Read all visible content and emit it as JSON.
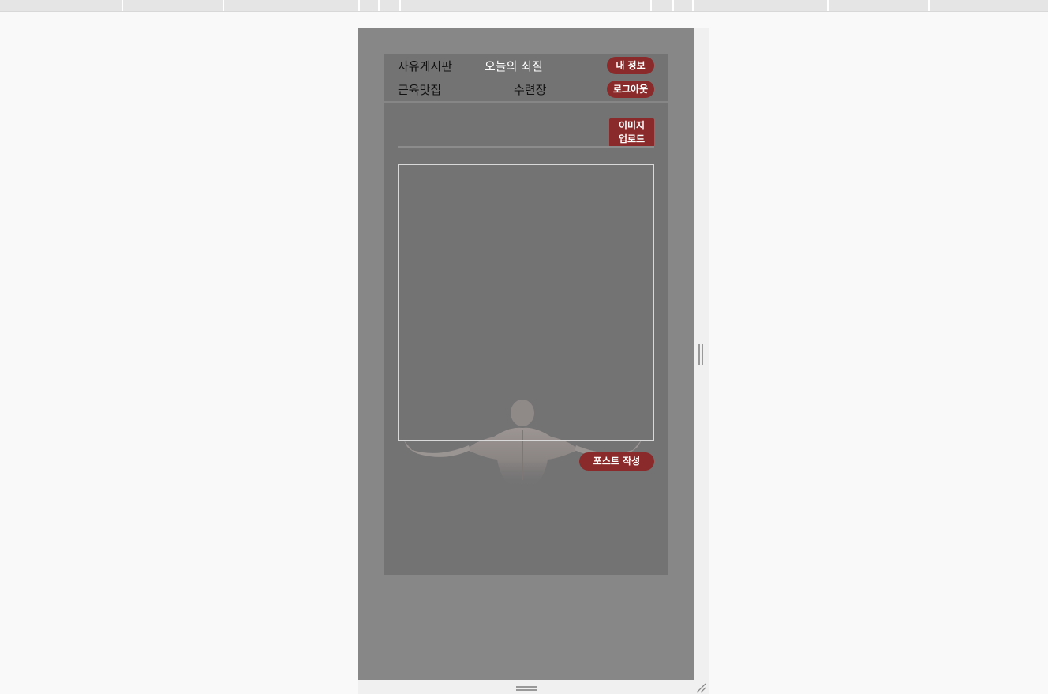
{
  "nav": {
    "free_board": "자유게시판",
    "todays_workout": "오늘의 쇠질",
    "muscle_food": "근육맛집",
    "dojo": "수련장",
    "my_info": "내 정보",
    "logout": "로그아웃"
  },
  "editor": {
    "upload_label_line1": "이미지",
    "upload_label_line2": "업로드",
    "submit_label": "포스트 작성"
  },
  "colors": {
    "accent": "#8b2a2a",
    "app_bg": "#737373",
    "device_bg": "#878787",
    "page_bg": "#f9f9f9"
  },
  "icons": {
    "side_resize": "vertical-resize-handle-icon",
    "bottom_resize": "horizontal-resize-handle-icon",
    "corner_resize": "corner-resize-icon"
  }
}
